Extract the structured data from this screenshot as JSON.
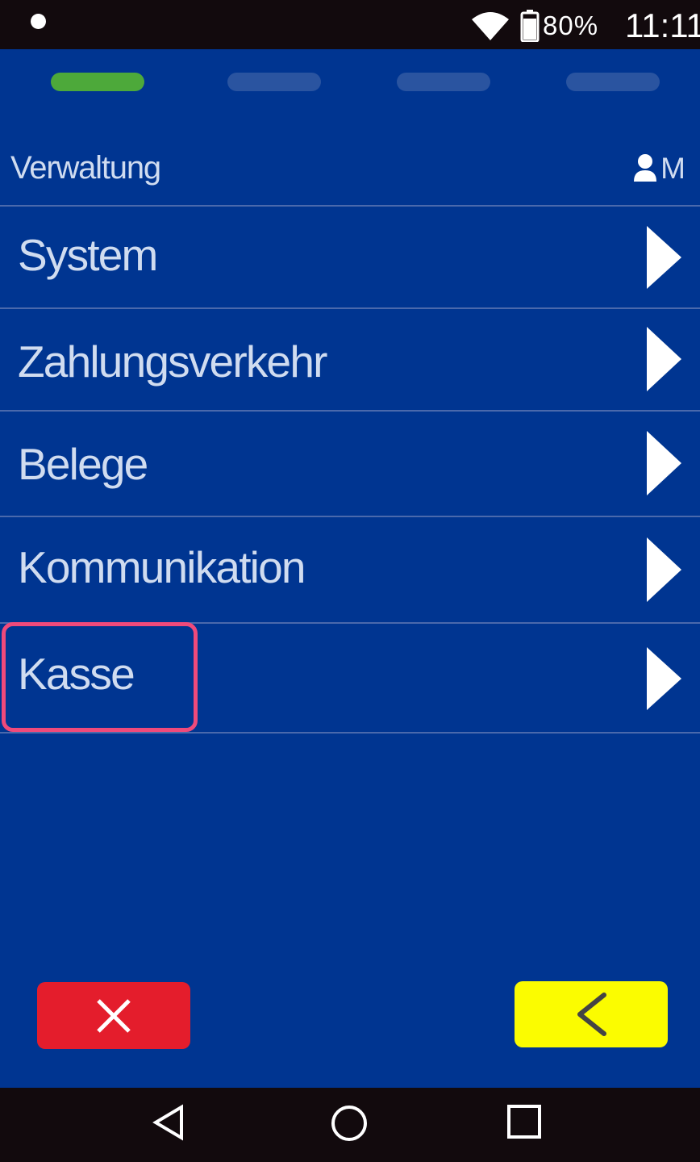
{
  "status_bar": {
    "battery_percent": "80%",
    "time": "11:11",
    "icons": [
      "notification-dot",
      "wifi-icon",
      "battery-icon"
    ]
  },
  "progress": {
    "total_steps": 4,
    "active_step": 1,
    "active_color": "#4da93a",
    "inactive_color": "#2a54a0"
  },
  "header": {
    "title": "Verwaltung",
    "user_label": "M",
    "user_icon": "person-icon"
  },
  "menu": {
    "items": [
      {
        "label": "System",
        "icon": "chevron-right-icon"
      },
      {
        "label": "Zahlungsverkehr",
        "icon": "chevron-right-icon"
      },
      {
        "label": "Belege",
        "icon": "chevron-right-icon"
      },
      {
        "label": "Kommunikation",
        "icon": "chevron-right-icon"
      },
      {
        "label": "Kasse",
        "icon": "chevron-right-icon",
        "highlighted": true
      }
    ]
  },
  "actions": {
    "cancel": {
      "icon": "close-icon",
      "color": "#e41d2c"
    },
    "back": {
      "icon": "chevron-left-icon",
      "color": "#fbfc00"
    }
  },
  "nav_bar": {
    "icons": [
      "nav-back-icon",
      "nav-home-icon",
      "nav-recents-icon"
    ]
  },
  "colors": {
    "background": "#003591",
    "text": "#d0dcf0",
    "divider": "#4a69ac",
    "highlight": "#ef4a7b",
    "system_bar": "#120a0d"
  }
}
